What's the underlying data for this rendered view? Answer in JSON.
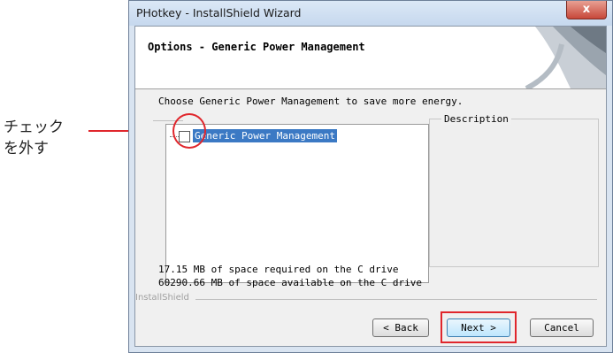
{
  "annotation": {
    "line1": "チェック",
    "line2": "を外す",
    "accent_color": "#e0262c"
  },
  "window": {
    "title": "PHotkey - InstallShield Wizard",
    "close_glyph": "x",
    "header_title": "Options - Generic Power Management",
    "instruction": "Choose Generic Power Management to save more energy.",
    "tree_item": "Generic Power Management",
    "tree_item_checked": false,
    "description_label": "Description",
    "space_required": "17.15 MB of space required on the C drive",
    "space_available": "60290.66 MB of space available on the C drive",
    "brand": "InstallShield",
    "buttons": {
      "back": "< Back",
      "next": "Next >",
      "cancel": "Cancel"
    }
  }
}
